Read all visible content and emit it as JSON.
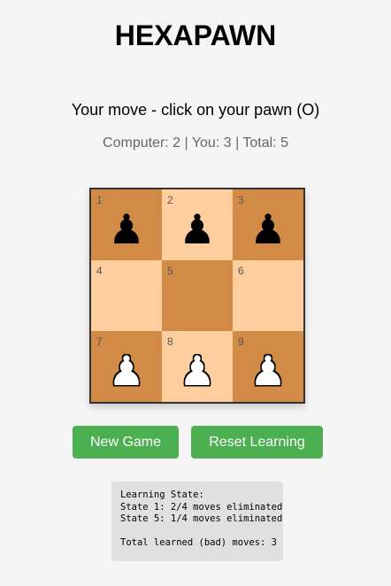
{
  "title": "HEXAPAWN",
  "status_text": "Your move - click on your pawn (O)",
  "score_text": "Computer: 2 | You: 3 | Total: 5",
  "colors": {
    "dark_square": "#d18b47",
    "light_square": "#ffce9e",
    "button": "#4caf50",
    "board_border": "#333333"
  },
  "board": {
    "cells": [
      {
        "number": "1",
        "piece": "♟",
        "piece_color": "black",
        "square": "dark"
      },
      {
        "number": "2",
        "piece": "♟",
        "piece_color": "black",
        "square": "light"
      },
      {
        "number": "3",
        "piece": "♟",
        "piece_color": "black",
        "square": "dark"
      },
      {
        "number": "4",
        "piece": "",
        "piece_color": "",
        "square": "light"
      },
      {
        "number": "5",
        "piece": "",
        "piece_color": "",
        "square": "dark"
      },
      {
        "number": "6",
        "piece": "",
        "piece_color": "",
        "square": "light"
      },
      {
        "number": "7",
        "piece": "♟",
        "piece_color": "white",
        "square": "dark"
      },
      {
        "number": "8",
        "piece": "♟",
        "piece_color": "white",
        "square": "light"
      },
      {
        "number": "9",
        "piece": "♟",
        "piece_color": "white",
        "square": "dark"
      }
    ]
  },
  "buttons": {
    "new_game": "New Game",
    "reset_learning": "Reset Learning"
  },
  "learning": {
    "heading": "Learning State:",
    "line1": "State 1: 2/4 moves eliminated",
    "line2": "State 5: 1/4 moves eliminated",
    "total": "Total learned (bad) moves: 3"
  }
}
